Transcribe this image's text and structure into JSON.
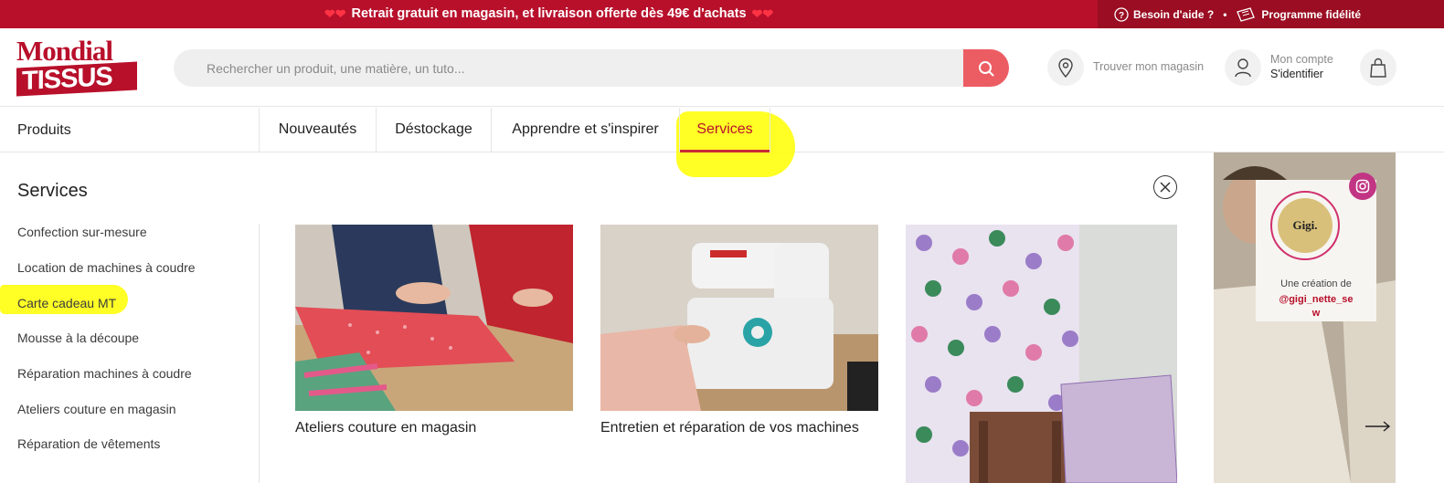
{
  "topbar": {
    "promo": "Retrait gratuit en magasin, et livraison offerte dès 49€ d'achats",
    "help": "Besoin d'aide ?",
    "loyalty": "Programme fidélité"
  },
  "logo": {
    "line1": "Mondial",
    "line2": "TISSUS"
  },
  "search": {
    "placeholder": "Rechercher un produit, une matière, un tuto..."
  },
  "header": {
    "store": "Trouver mon magasin",
    "account_label": "Mon compte",
    "account_action": "S'identifier"
  },
  "nav": {
    "products": "Produits",
    "items": [
      "Nouveautés",
      "Déstockage",
      "Apprendre et s'inspirer",
      "Services"
    ]
  },
  "panel": {
    "title": "Services",
    "links": [
      "Confection sur-mesure",
      "Location de machines à coudre",
      "Carte cadeau MT",
      "Mousse à la découpe",
      "Réparation machines à coudre",
      "Ateliers couture en magasin",
      "Réparation de vêtements"
    ],
    "cards": [
      {
        "caption": "Ateliers couture en magasin"
      },
      {
        "caption": "Entretien et réparation de vos machines"
      },
      {
        "caption": ""
      }
    ]
  },
  "instagram": {
    "badge": "Gigi.",
    "line1": "Une création de",
    "handle": "@gigi_nette_se w"
  },
  "colors": {
    "brand": "#b8102b",
    "search_button": "#ec5d63",
    "highlight": "#ffff00"
  }
}
